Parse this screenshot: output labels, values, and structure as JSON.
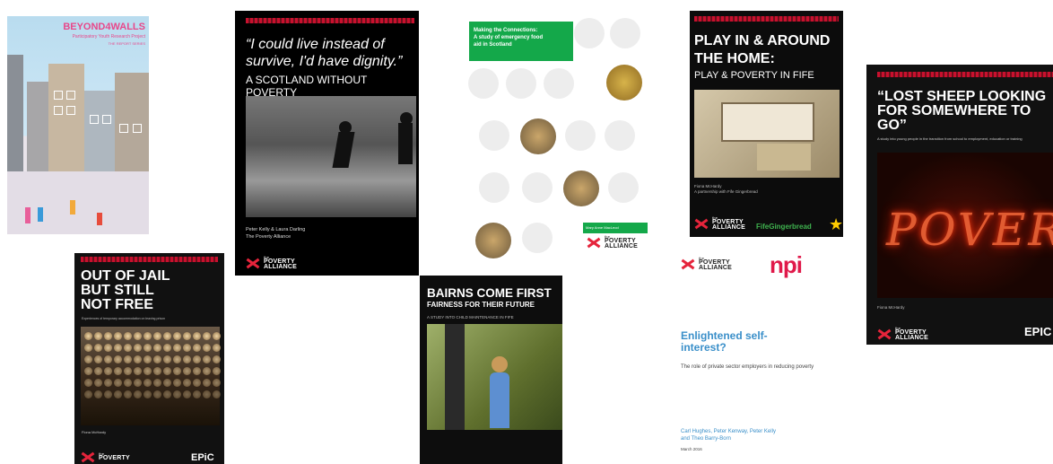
{
  "covers": {
    "beyond4walls": {
      "title": "BEYOND4WALLS",
      "subtitle": "Participatory Youth Research Project",
      "tag": "THE REPORT SERIES"
    },
    "out_of_jail": {
      "title_line1": "OUT OF JAIL",
      "title_line2": "BUT STILL",
      "title_line3": "NOT FREE",
      "subtitle": "Experiences of temporary accommodation on leaving prison",
      "author": "Fiona McHardy",
      "epic": "EPiC"
    },
    "scotland": {
      "quote": "“I could live instead of survive, I'd have dignity.”",
      "subtitle": "A SCOTLAND WITHOUT POVERTY",
      "author_line1": "Peter Kelly & Laura Darling",
      "author_line2": "The Poverty Alliance"
    },
    "connections": {
      "banner_line1": "Making the Connections:",
      "banner_line2": "A study of emergency food",
      "banner_line3": "aid in Scotland",
      "author_tag": "Mary Anne MacLeod"
    },
    "bairns": {
      "title": "BAIRNS COME FIRST",
      "subtitle": "FAIRNESS FOR THEIR FUTURE",
      "subtitle2": "A STUDY INTO CHILD MAINTENANCE IN FIFE"
    },
    "play": {
      "title_line1": "PLAY IN & AROUND",
      "title_line2": "THE HOME:",
      "subtitle": "PLAY & POVERTY IN FIFE",
      "author_line1": "Fiona McHardy",
      "author_line2": "A partnership with Fife Gingerbread",
      "partner": "FifeGingerbread"
    },
    "enlightened": {
      "npi": "npi",
      "title_line1": "Enlightened self-",
      "title_line2": "interest?",
      "subtitle": "The role of private sector employers in reducing poverty",
      "authors_line1": "Carl Hughes, Peter Kenway, Peter Kelly",
      "authors_line2": "and Theo Barry-Born",
      "date": "March 2016"
    },
    "lost_sheep": {
      "title": "“LOST SHEEP LOOKING FOR SOMEWHERE TO GO”",
      "subtitle": "A study into young people in the transition from school to employment, education or training",
      "neon": "POVERTY",
      "author": "Fiona McHardy",
      "epic": "EPIC"
    }
  },
  "poverty_alliance": {
    "small": "the",
    "big_line1": "POVERTY",
    "big_line2": "ALLIANCE"
  },
  "colors": {
    "poverty_red": "#e5243b",
    "epic_green": "#14a84a",
    "npi_red": "#e0194a",
    "link_blue": "#3a8fc9"
  }
}
